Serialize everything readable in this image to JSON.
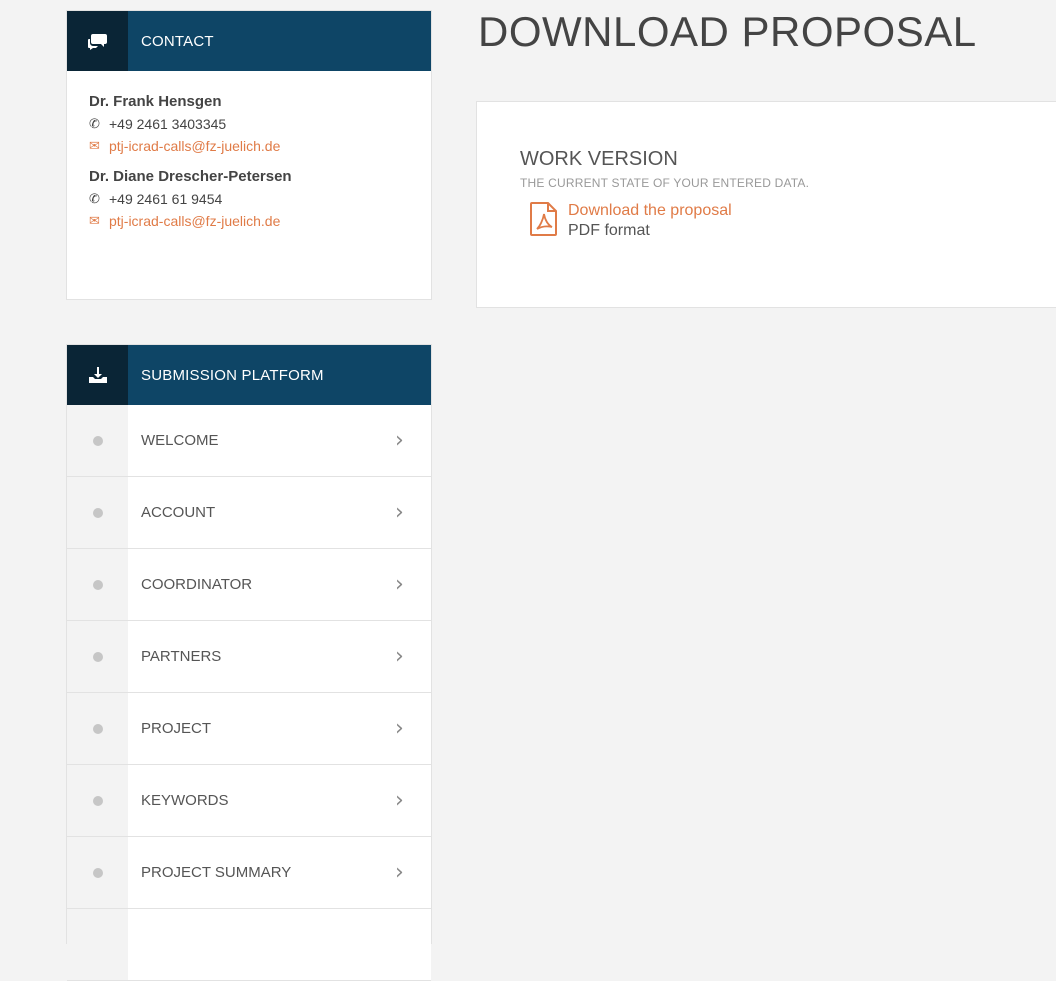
{
  "page_title": "DOWNLOAD PROPOSAL",
  "contact": {
    "heading": "CONTACT",
    "icon": "chat-bubbles-icon",
    "people": [
      {
        "name": "Dr. Frank Hensgen",
        "phone": "+49 2461 3403345",
        "email": "ptj-icrad-calls@fz-juelich.de"
      },
      {
        "name": "Dr. Diane Drescher-Petersen",
        "phone": "+49 2461 61 9454",
        "email": "ptj-icrad-calls@fz-juelich.de"
      }
    ]
  },
  "platform": {
    "heading": "SUBMISSION PLATFORM",
    "icon": "download-tray-icon",
    "items": [
      {
        "label": "WELCOME"
      },
      {
        "label": "ACCOUNT"
      },
      {
        "label": "COORDINATOR"
      },
      {
        "label": "PARTNERS"
      },
      {
        "label": "PROJECT"
      },
      {
        "label": "KEYWORDS"
      },
      {
        "label": "PROJECT SUMMARY"
      }
    ]
  },
  "work_version": {
    "title": "WORK VERSION",
    "subtitle": "THE CURRENT STATE OF YOUR ENTERED DATA.",
    "download_link": "Download the proposal",
    "format": "PDF format",
    "icon": "pdf-file-icon"
  },
  "colors": {
    "header_bg": "#0e4566",
    "header_icon_bg": "#0a2536",
    "accent": "#e07b47"
  }
}
